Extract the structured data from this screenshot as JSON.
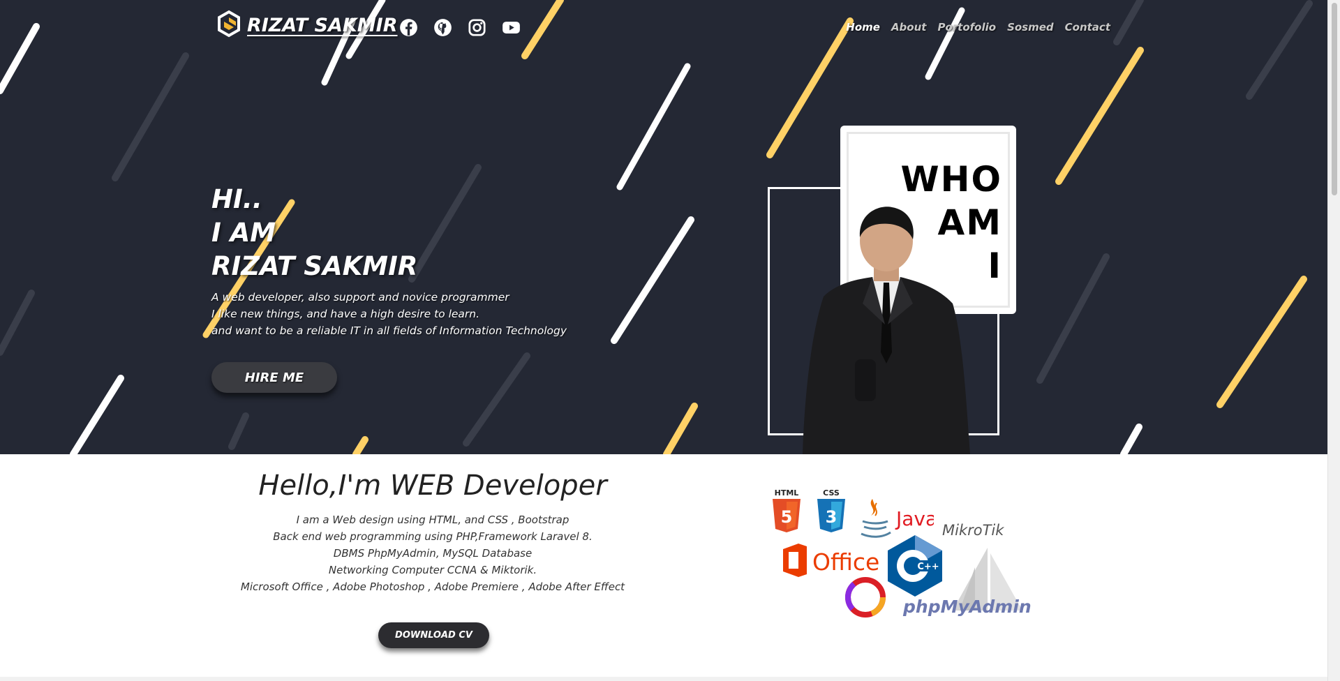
{
  "header": {
    "brand": " RIZAT SAKMIR",
    "brand_icon": "hexagon-logo-icon",
    "social_icons": [
      "facebook-icon",
      "github-icon",
      "instagram-icon",
      "youtube-icon"
    ],
    "nav": [
      "Home",
      "About",
      "Portofolio",
      "Sosmed",
      "Contact"
    ],
    "active_nav": "Home"
  },
  "hero": {
    "line1": "HI..",
    "line2": "I AM",
    "line3": "RIZAT SAKMIR",
    "bio1": "A web developer, also support and novice programmer",
    "bio2": "I like new things, and have a high desire to learn.",
    "bio3": "and want to be a reliable IT in all fields of Information Technology",
    "hire_label": "HIRE ME",
    "who1": "WHO",
    "who2": "AM",
    "who3": "I"
  },
  "about": {
    "title": "Hello,I'm WEB Developer",
    "line1": "I am a Web design using HTML, and CSS , Bootstrap",
    "line2": "Back end web programming using PHP,Framework Laravel 8.",
    "line3": "DBMS PhpMyAdmin, MySQL Database",
    "line4": "Networking Computer CCNA & Miktorik.",
    "line5": "Microsoft Office , Adobe Photoshop , Adobe Premiere , Adobe After Effect",
    "download_label": "DOWNLOAD CV"
  },
  "logos": {
    "html": "HTML",
    "html_num": "5",
    "css": "CSS",
    "css_num": "3",
    "java": "Java",
    "mikrotik": "MikroTik",
    "office": "Office",
    "cpp": "C++",
    "pma": "phpMyAdmin"
  },
  "colors": {
    "background_dark": "#242834",
    "accent_yellow": "#ffd166",
    "white": "#ffffff"
  }
}
